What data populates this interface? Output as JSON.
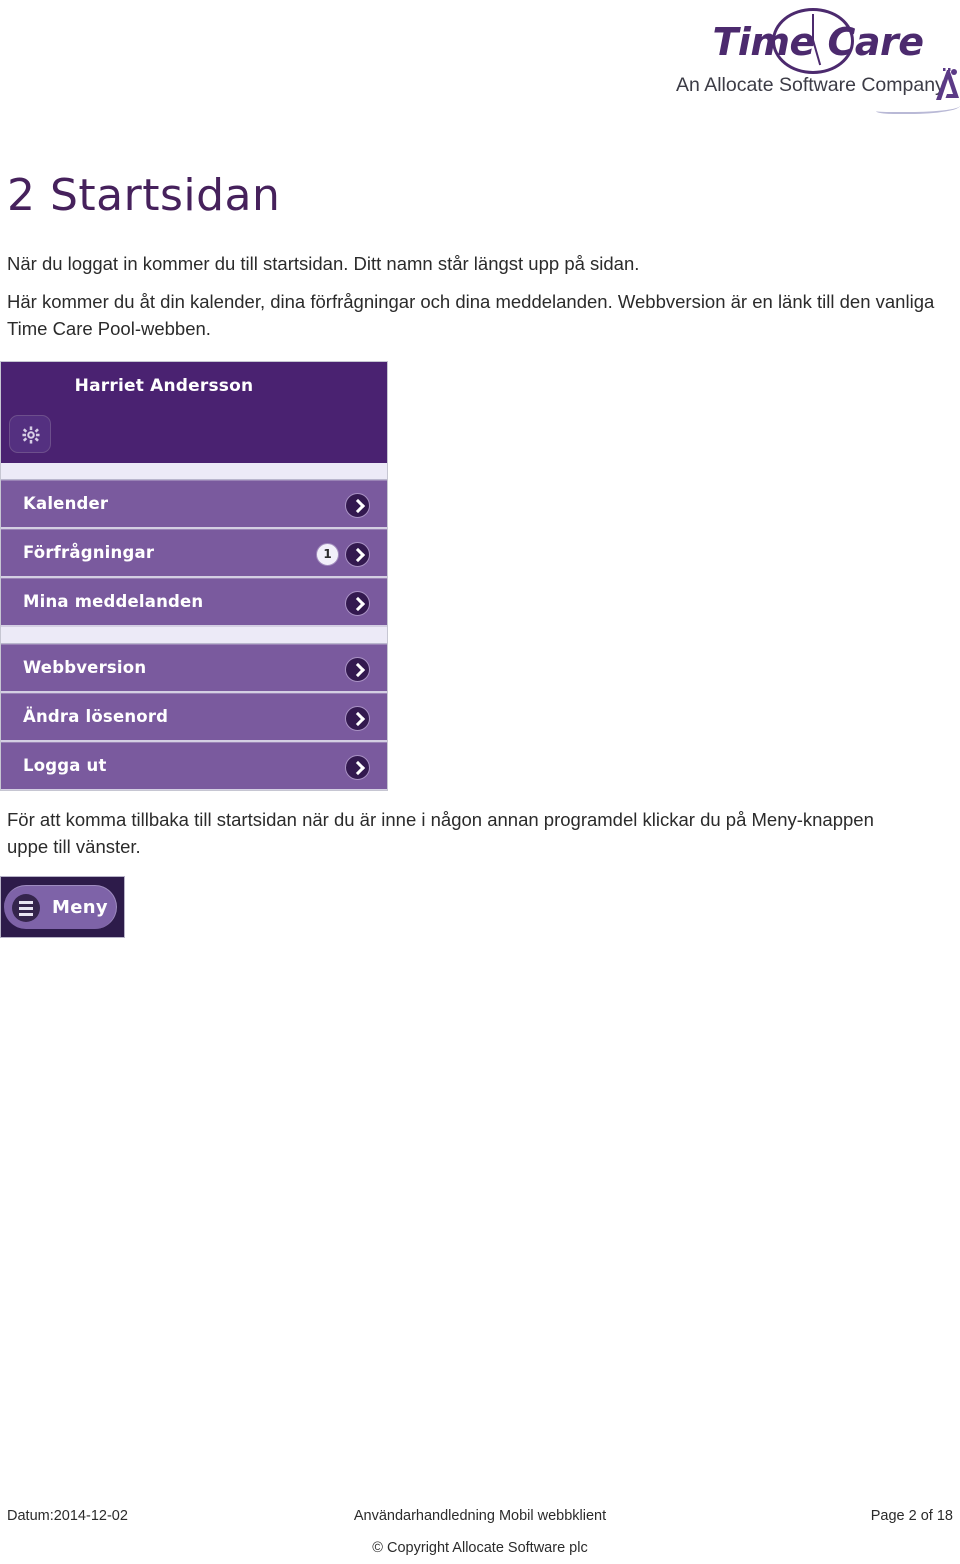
{
  "logo": {
    "wordmark": "Time Care",
    "tagline": "An Allocate Software Company",
    "brand_color": "#4c2a6e"
  },
  "heading": "2 Startsidan",
  "paragraphs": {
    "p1": "När du loggat in kommer du till startsidan. Ditt namn står längst upp på sidan.",
    "p2": "Här kommer du åt din kalender, dina förfrågningar och dina meddelanden.  Webbversion är en länk till den vanliga Time Care Pool-webben.",
    "p3": "För att komma tillbaka till startsidan när du är inne i någon annan programdel klickar du på Meny-knappen uppe till vänster."
  },
  "app_screenshot": {
    "user_name": "Harriet Andersson",
    "settings_icon": "gear-icon",
    "header_color": "#4a2271",
    "row_color": "#7a5a9e",
    "group_1": [
      {
        "label": "Kalender",
        "badge": null
      },
      {
        "label": "Förfrågningar",
        "badge": "1"
      },
      {
        "label": "Mina meddelanden",
        "badge": null
      }
    ],
    "group_2": [
      {
        "label": "Webbversion",
        "badge": null
      },
      {
        "label": "Ändra lösenord",
        "badge": null
      },
      {
        "label": "Logga ut",
        "badge": null
      }
    ]
  },
  "meny_button": {
    "label": "Meny",
    "icon": "hamburger-icon",
    "background_color": "#2d1b4a",
    "pill_color": "#7e63a8"
  },
  "footer": {
    "date": "Datum:2014-12-02",
    "document_title": "Användarhandledning Mobil webbklient",
    "page": "Page 2 of 18",
    "copyright": "© Copyright Allocate Software plc"
  }
}
